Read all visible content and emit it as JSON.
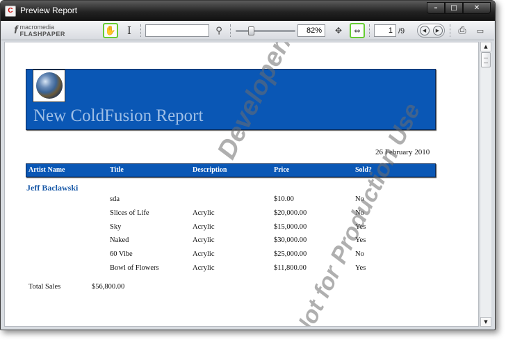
{
  "window": {
    "title": "Preview Report",
    "app_icon_glyph": "C",
    "controls": {
      "minimize": "–",
      "maximize": "□",
      "close": "✕"
    }
  },
  "toolbar": {
    "logo_top": "macromedia",
    "logo_bottom": "FLASHPAPER",
    "search_value": "",
    "zoom": "82%",
    "page_current": "1",
    "page_total": "/9",
    "zoom_slider_fraction": 0.25,
    "icons": [
      "hand-tool-icon",
      "text-select-icon",
      "search-icon",
      "fit-page-icon",
      "fit-width-icon",
      "previous-page-icon",
      "next-page-icon",
      "print-icon",
      "options-icon"
    ]
  },
  "report": {
    "title": "New ColdFusion Report",
    "date": "26 February 2010",
    "columns": [
      "Artist Name",
      "Title",
      "Description",
      "Price",
      "Sold?"
    ],
    "group_name": "Jeff Baclawski",
    "rows": [
      {
        "title": "sda",
        "description": "",
        "price": "$10.00",
        "sold": "No"
      },
      {
        "title": "Slices of Life",
        "description": "Acrylic",
        "price": "$20,000.00",
        "sold": "No"
      },
      {
        "title": "Sky",
        "description": "Acrylic",
        "price": "$15,000.00",
        "sold": "Yes"
      },
      {
        "title": "Naked",
        "description": "Acrylic",
        "price": "$30,000.00",
        "sold": "Yes"
      },
      {
        "title": "60 Vibe",
        "description": "Acrylic",
        "price": "$25,000.00",
        "sold": "No"
      },
      {
        "title": "Bowl of Flowers",
        "description": "Acrylic",
        "price": "$11,800.00",
        "sold": "Yes"
      }
    ],
    "total_label": "Total Sales",
    "total_value": "$56,800.00",
    "watermark_line1": "Developer/Trial Edition",
    "watermark_line2": "Not for Production Use"
  },
  "colors": {
    "banner_blue": "#0a57b5",
    "title_text": "#9fbfe6",
    "group_text": "#1a5aa8",
    "toolbar_highlight": "#66cc33"
  }
}
